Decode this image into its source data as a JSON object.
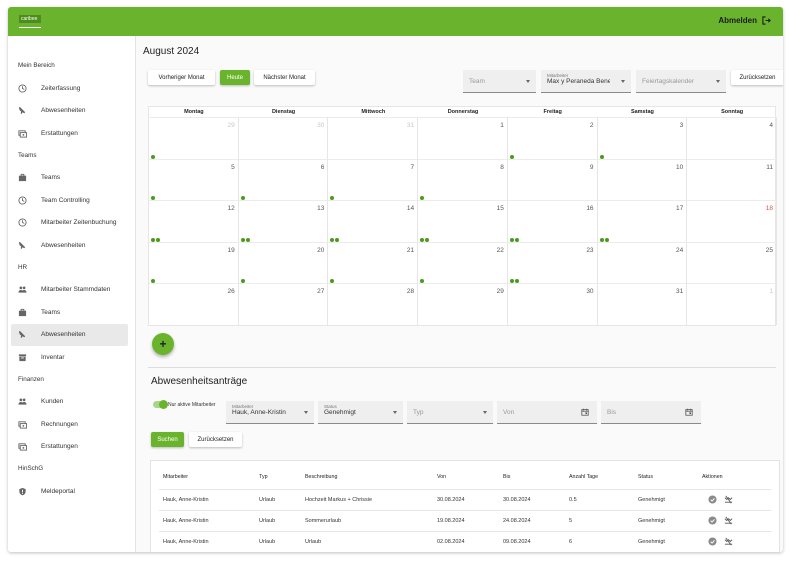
{
  "header": {
    "logo_text": "caribee",
    "logout_label": "Abmelden"
  },
  "sidebar": {
    "sections": [
      {
        "title": "Mein Bereich",
        "items": [
          {
            "label": "Zeiterfassung",
            "icon": "clock-icon"
          },
          {
            "label": "Abwesenheiten",
            "icon": "plane-icon"
          },
          {
            "label": "Erstattungen",
            "icon": "money-icon"
          }
        ]
      },
      {
        "title": "Teams",
        "items": [
          {
            "label": "Teams",
            "icon": "briefcase-icon"
          },
          {
            "label": "Team Controlling",
            "icon": "clock-icon"
          },
          {
            "label": "Mitarbeiter Zeitenbuchung",
            "icon": "clock-icon"
          },
          {
            "label": "Abwesenheiten",
            "icon": "plane-icon"
          }
        ]
      },
      {
        "title": "HR",
        "items": [
          {
            "label": "Mitarbeiter Stammdaten",
            "icon": "people-icon"
          },
          {
            "label": "Teams",
            "icon": "briefcase-icon"
          },
          {
            "label": "Abwesenheiten",
            "icon": "plane-icon",
            "active": true
          },
          {
            "label": "Inventar",
            "icon": "archive-icon"
          }
        ]
      },
      {
        "title": "Finanzen",
        "items": [
          {
            "label": "Kunden",
            "icon": "people-icon"
          },
          {
            "label": "Rechnungen",
            "icon": "money-icon"
          },
          {
            "label": "Erstattungen",
            "icon": "money-icon"
          }
        ]
      },
      {
        "title": "HinSchG",
        "items": [
          {
            "label": "Meldeportal",
            "icon": "shield-icon"
          }
        ]
      }
    ]
  },
  "calendar": {
    "title": "August 2024",
    "prev_label": "Vorheriger Monat",
    "today_label": "Heute",
    "next_label": "Nächster Monat",
    "filters": {
      "team_placeholder": "Team",
      "employee_label": "Mitarbeiter",
      "employee_value": "Max y Peraneda Benedikt",
      "holiday_placeholder": "Feiertagskalender",
      "reset_label": "Zurücksetzen"
    },
    "weekdays": [
      "Montag",
      "Dienstag",
      "Mittwoch",
      "Donnerstag",
      "Freitag",
      "Samstag",
      "Sonntag"
    ],
    "weeks": [
      [
        {
          "d": "29",
          "dim": true
        },
        {
          "d": "30",
          "dim": true
        },
        {
          "d": "31",
          "dim": true
        },
        {
          "d": "1"
        },
        {
          "d": "2"
        },
        {
          "d": "3"
        },
        {
          "d": "4"
        }
      ],
      [
        {
          "d": "5"
        },
        {
          "d": "6"
        },
        {
          "d": "7"
        },
        {
          "d": "8"
        },
        {
          "d": "9"
        },
        {
          "d": "10"
        },
        {
          "d": "11"
        }
      ],
      [
        {
          "d": "12"
        },
        {
          "d": "13"
        },
        {
          "d": "14"
        },
        {
          "d": "15"
        },
        {
          "d": "16"
        },
        {
          "d": "17"
        },
        {
          "d": "18",
          "red": true
        }
      ],
      [
        {
          "d": "19"
        },
        {
          "d": "20"
        },
        {
          "d": "21"
        },
        {
          "d": "22"
        },
        {
          "d": "23"
        },
        {
          "d": "24"
        },
        {
          "d": "25"
        }
      ],
      [
        {
          "d": "26"
        },
        {
          "d": "27"
        },
        {
          "d": "28"
        },
        {
          "d": "29"
        },
        {
          "d": "30"
        },
        {
          "d": "31"
        },
        {
          "d": "1",
          "dim": true
        }
      ]
    ],
    "markers": [
      {
        "week": 0,
        "day": 0,
        "count": 1,
        "check": true
      },
      {
        "week": 0,
        "day": 4,
        "count": 1
      },
      {
        "week": 0,
        "day": 5,
        "count": 1
      },
      {
        "week": 1,
        "day": 0,
        "count": 1
      },
      {
        "week": 1,
        "day": 1,
        "count": 1
      },
      {
        "week": 1,
        "day": 2,
        "count": 1
      },
      {
        "week": 1,
        "day": 3,
        "count": 1
      },
      {
        "week": 2,
        "day": 0,
        "count": 2
      },
      {
        "week": 2,
        "day": 1,
        "count": 2
      },
      {
        "week": 2,
        "day": 2,
        "count": 2
      },
      {
        "week": 2,
        "day": 3,
        "count": 2
      },
      {
        "week": 2,
        "day": 4,
        "count": 2
      },
      {
        "week": 2,
        "day": 5,
        "count": 2
      },
      {
        "week": 3,
        "day": 0,
        "count": 1
      },
      {
        "week": 3,
        "day": 1,
        "count": 1
      },
      {
        "week": 3,
        "day": 2,
        "count": 1
      },
      {
        "week": 3,
        "day": 3,
        "count": 1
      },
      {
        "week": 3,
        "day": 4,
        "count": 2
      }
    ],
    "add_label": "+"
  },
  "requests": {
    "title": "Abwesenheitsanträge",
    "toggle_label": "Nur aktive Mitarbeiter",
    "employee_label": "Mitarbeiter",
    "employee_value": "Hauk, Anne-Kristin",
    "status_label": "Status",
    "status_value": "Genehmigt",
    "type_placeholder": "Typ",
    "from_placeholder": "Von",
    "to_placeholder": "Bis",
    "search_label": "Suchen",
    "reset_label": "Zurücksetzen",
    "columns": [
      "Mitarbeiter",
      "Typ",
      "Beschreibung",
      "Von",
      "Bis",
      "Anzahl Tage",
      "Status",
      "Aktionen"
    ],
    "rows": [
      [
        "Hauk, Anne-Kristin",
        "Urlaub",
        "Hochzeit Markus + Chrissie",
        "30.08.2024",
        "30.08.2024",
        "0.5",
        "Genehmigt"
      ],
      [
        "Hauk, Anne-Kristin",
        "Urlaub",
        "Sommerurlaub",
        "19.08.2024",
        "24.08.2024",
        "5",
        "Genehmigt"
      ],
      [
        "Hauk, Anne-Kristin",
        "Urlaub",
        "Urlaub",
        "02.08.2024",
        "09.08.2024",
        "6",
        "Genehmigt"
      ]
    ]
  }
}
